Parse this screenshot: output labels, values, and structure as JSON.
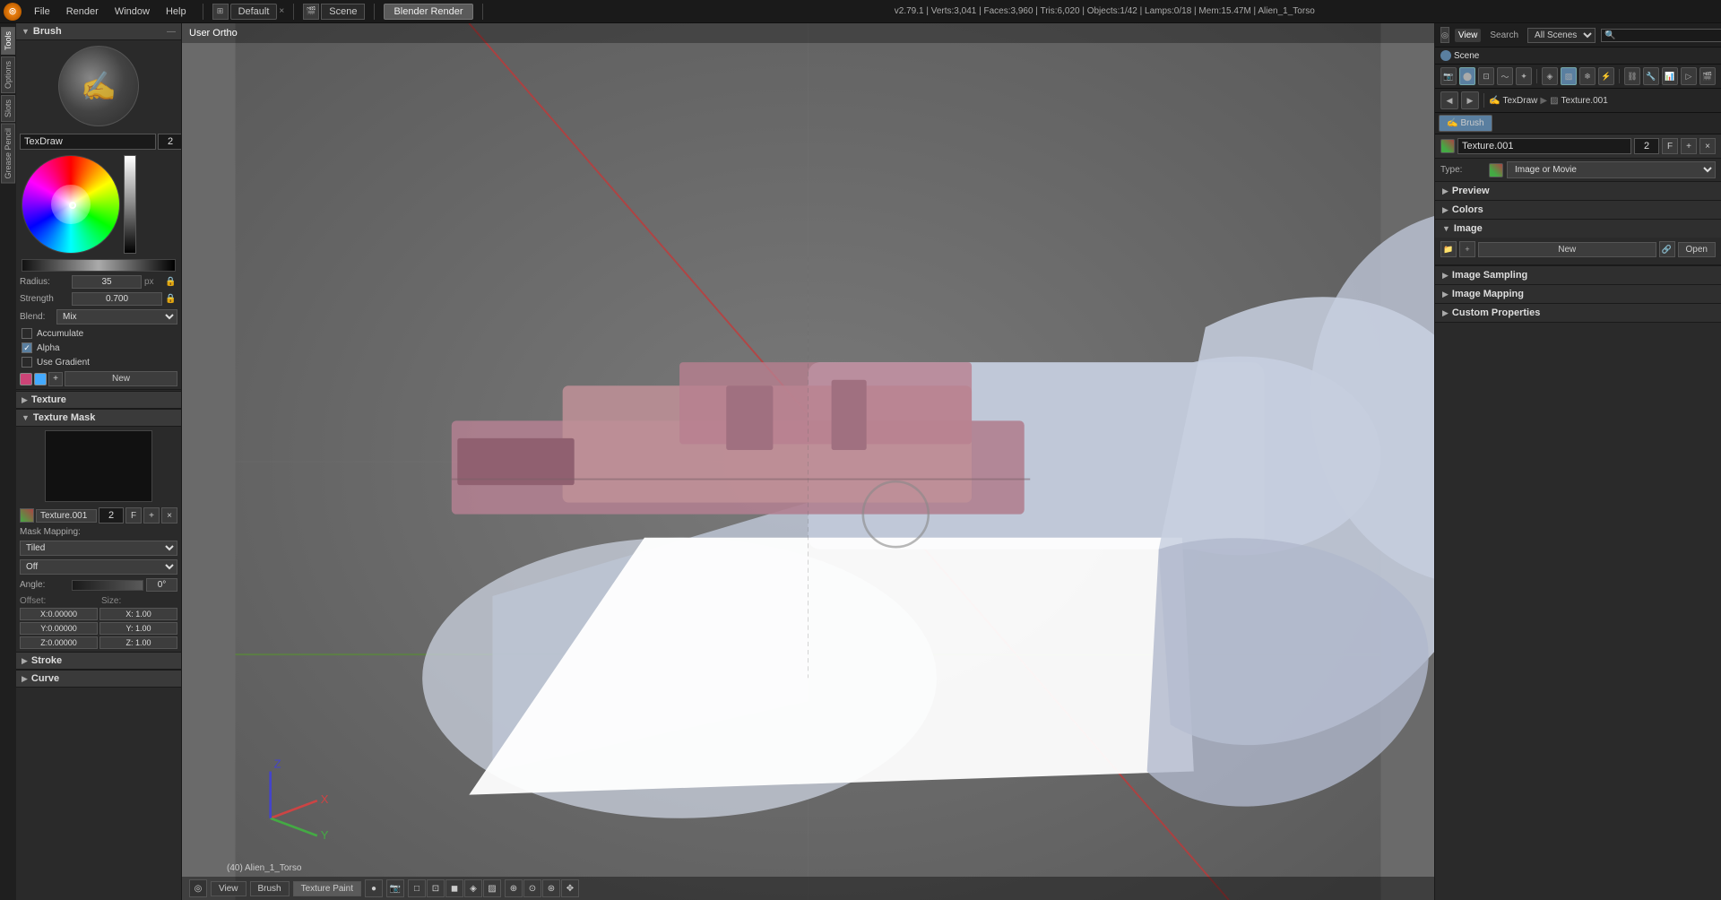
{
  "topbar": {
    "menus": [
      "File",
      "Render",
      "Window",
      "Help"
    ],
    "workspace": "Default",
    "scene_label": "Scene",
    "render_engine": "Blender Render",
    "info": "v2.79.1 | Verts:3,041 | Faces:3,960 | Tris:6,020 | Objects:1/42 | Lamps:0/18 | Mem:15.47M | Alien_1_Torso",
    "view_tab": "View",
    "search_tab": "Search",
    "all_scenes": "All Scenes",
    "scene_name": "Scene"
  },
  "left_panel": {
    "brush_label": "Brush",
    "brush_name": "TexDraw",
    "brush_number": "2",
    "radius_label": "Radius:",
    "radius_value": "35",
    "radius_unit": "px",
    "strength_label": "Strength",
    "strength_value": "0.700",
    "blend_label": "Blend:",
    "blend_value": "Mix",
    "accumulate_label": "Accumulate",
    "alpha_label": "Alpha",
    "use_gradient_label": "Use Gradient",
    "alpha_checked": true,
    "new_btn_label": "New",
    "texture_label": "Texture",
    "texture_mask_label": "Texture Mask",
    "texture_slot_name": "Texture.001",
    "mask_mapping_label": "Mask Mapping:",
    "tiled_label": "Tiled",
    "off_label": "Off",
    "angle_label": "Angle:",
    "angle_value": "0°",
    "offset_label": "Offset:",
    "size_label": "Size:",
    "x_offset": "X:0.00000",
    "y_offset": "Y:0.00000",
    "z_offset": "Z:0.00000",
    "x_size": "X: 1.00",
    "y_size": "Y: 1.00",
    "z_size": "Z: 1.00",
    "stroke_label": "Stroke",
    "curve_label": "Curve"
  },
  "viewport": {
    "title": "User Ortho",
    "object_label": "(40) Alien_1_Torso"
  },
  "right_panel": {
    "view_label": "View",
    "search_label": "Search",
    "all_scenes_label": "All Scenes",
    "scene_label": "Scene",
    "toolbar_icons": [
      "camera",
      "sphere",
      "cube",
      "mesh",
      "brush",
      "texture",
      "modifier",
      "particle",
      "constraint",
      "data",
      "scene",
      "render"
    ],
    "breadcrumb": [
      "TexDraw",
      "Texture.001"
    ],
    "brush_tab_label": "Brush",
    "texture_name": "Texture.001",
    "texture_number": "2",
    "type_label": "Type:",
    "type_value": "Image or Movie",
    "preview_label": "Preview",
    "colors_label": "Colors",
    "image_label": "Image",
    "new_btn": "New",
    "open_btn": "Open",
    "image_sampling_label": "Image Sampling",
    "image_mapping_label": "Image Mapping",
    "custom_properties_label": "Custom Properties"
  },
  "bottom_bar": {
    "view_btn": "View",
    "brush_btn": "Brush",
    "texture_paint_btn": "Texture Paint",
    "object_mode": "(40) Alien_1_Torso"
  }
}
